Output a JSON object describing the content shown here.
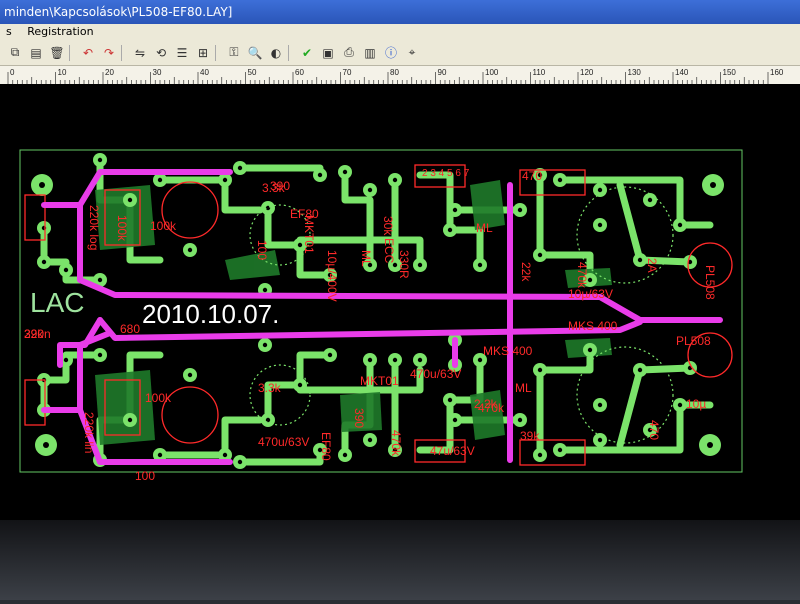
{
  "window": {
    "title": "minden\\Kapcsolások\\PL508-EF80.LAY]"
  },
  "menu": {
    "items": [
      "s",
      "Registration"
    ]
  },
  "ruler": {
    "ticks": [
      "0",
      "10",
      "20",
      "30",
      "40",
      "50",
      "60",
      "70",
      "80",
      "90",
      "100",
      "110",
      "120",
      "130",
      "140",
      "150",
      "160"
    ]
  },
  "colors": {
    "copper": "#7be36a",
    "silk": "#ff2a2a",
    "jumper": "#e93ce9",
    "board": "#000000",
    "outline": "#64c864"
  },
  "toolbar": {
    "icons": [
      "copy-icon",
      "paste-icon",
      "delete-icon",
      "undo-icon",
      "redo-icon",
      "mirror-icon",
      "rotate-icon",
      "align-icon",
      "group-icon",
      "lock-icon",
      "zoom-icon",
      "contrast-icon",
      "drc-icon",
      "photo-icon",
      "print-icon",
      "export-icon",
      "info-icon",
      "autoroute-icon"
    ]
  },
  "board": {
    "signature": "LAC",
    "date": "2010.10.07.",
    "labels": [
      "3.3k",
      "30k",
      "ML",
      "10µ/400V",
      "MKT01",
      "ECC",
      "390",
      "100",
      "EF80",
      "2 3 4 5 6 7",
      "330R",
      "ML",
      "22k",
      "470k",
      "2A",
      "PL508",
      "10µ/63V",
      "MKS 400",
      "MKS 400",
      "470k",
      "39k",
      "220k lin",
      "100k",
      "470u/63V",
      "220n",
      "220k log",
      "100k",
      "100k",
      "470u/63V",
      "3.3k",
      "EF80",
      "MKT01",
      "470k",
      "390",
      "ML",
      "2.2k",
      "39k",
      "680",
      "10µ",
      "470",
      "PL508",
      "47u/63V",
      "470",
      "100"
    ]
  }
}
